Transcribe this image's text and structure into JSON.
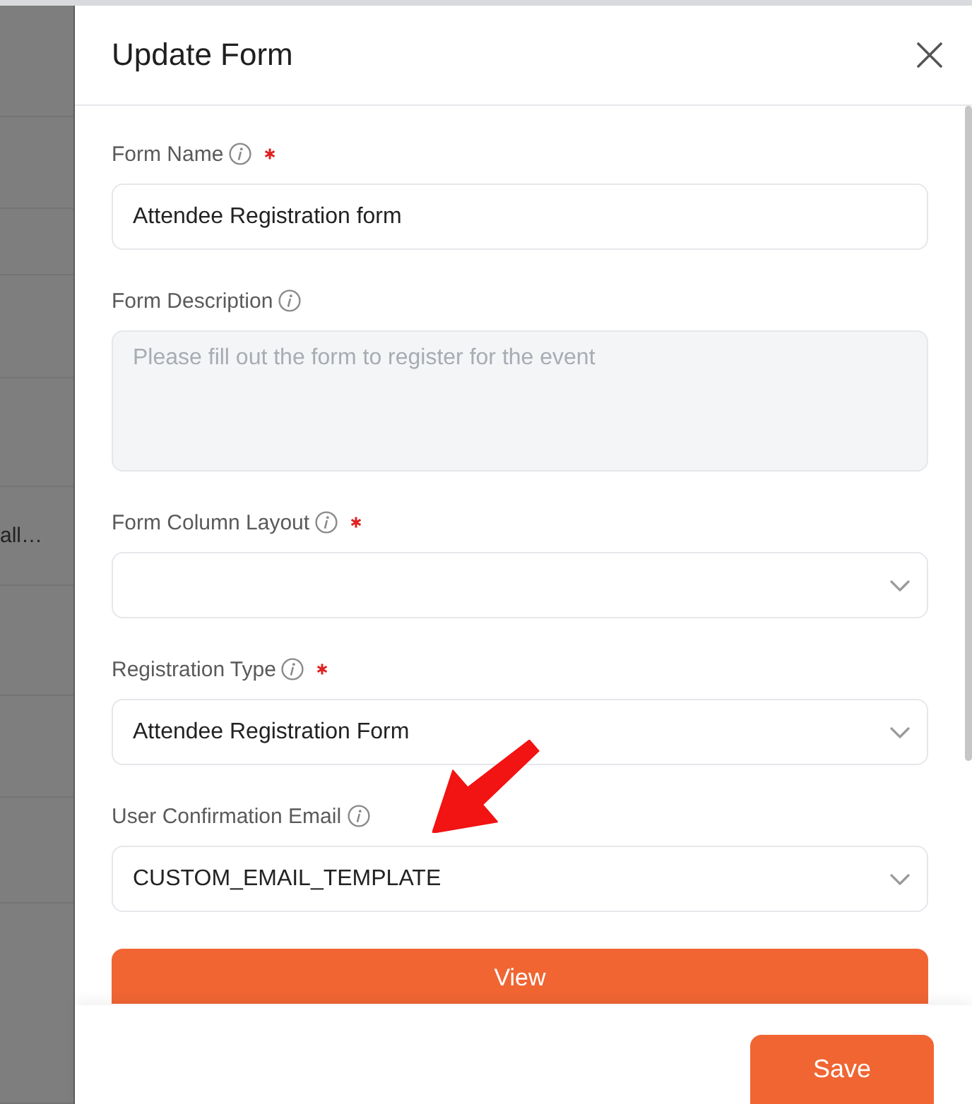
{
  "background_page": {
    "cut_text": "all…"
  },
  "dialog": {
    "title": "Update Form",
    "fields": [
      {
        "kind": "text",
        "label": "Form Name",
        "required": true,
        "disabled": false,
        "value": "Attendee Registration form"
      },
      {
        "kind": "textarea",
        "label": "Form Description",
        "required": false,
        "disabled": true,
        "placeholder": "Please fill out the form to register for the event"
      },
      {
        "kind": "select",
        "label": "Form Column Layout",
        "required": true,
        "disabled": false
      },
      {
        "kind": "select",
        "label": "Registration Type",
        "required": true,
        "disabled": false,
        "value": "Attendee Registration Form"
      },
      {
        "kind": "select",
        "label": "User Confirmation Email",
        "required": false,
        "disabled": false,
        "value": "CUSTOM_EMAIL_TEMPLATE"
      }
    ],
    "view_button": "View",
    "save_button": "Save"
  }
}
